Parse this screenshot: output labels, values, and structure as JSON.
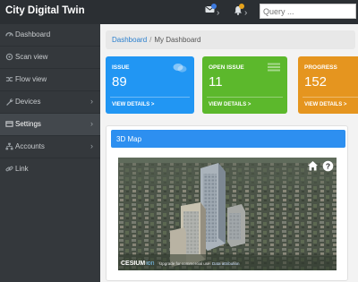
{
  "app": {
    "title": "City Digital Twin"
  },
  "topbar": {
    "search_placeholder": "Query ...",
    "icons": [
      "messages-icon",
      "notifications-icon"
    ],
    "badge_colors": [
      "#3d7be0",
      "#e6a21b"
    ]
  },
  "sidebar": {
    "items": [
      {
        "label": "Dashboard",
        "icon": "dashboard-icon",
        "has_children": false,
        "active": false
      },
      {
        "label": "Scan view",
        "icon": "scan-icon",
        "has_children": false,
        "active": false
      },
      {
        "label": "Flow view",
        "icon": "shuffle-icon",
        "has_children": false,
        "active": false
      },
      {
        "label": "Devices",
        "icon": "wrench-icon",
        "has_children": true,
        "active": false
      },
      {
        "label": "Settings",
        "icon": "settings-icon",
        "has_children": true,
        "active": true
      },
      {
        "label": "Accounts",
        "icon": "sitemap-icon",
        "has_children": true,
        "active": false
      },
      {
        "label": "Link",
        "icon": "link-icon",
        "has_children": false,
        "active": false
      }
    ]
  },
  "breadcrumb": {
    "home": "Dashboard",
    "current": "My Dashboard",
    "separator": "/"
  },
  "cards": [
    {
      "title": "ISSUE",
      "value": "89",
      "footer": "VIEW DETAILS >",
      "color": "#2196f3",
      "icon": "comments-icon"
    },
    {
      "title": "OPEN ISSUE",
      "value": "11",
      "footer": "VIEW DETAILS >",
      "color": "#5cb82c",
      "icon": "list-icon"
    },
    {
      "title": "PROGRESS",
      "value": "152",
      "footer": "VIEW DETAILS >",
      "color": "#e5951f",
      "icon": "chart-icon"
    }
  ],
  "map_panel": {
    "title": "3D Map",
    "logo_text": "CESIUM",
    "logo_suffix": "ion",
    "attribution_lead": "Upgrade for commercial use.",
    "attribution_link": "Data attribution",
    "buttons": [
      "home-icon",
      "help-icon"
    ]
  }
}
